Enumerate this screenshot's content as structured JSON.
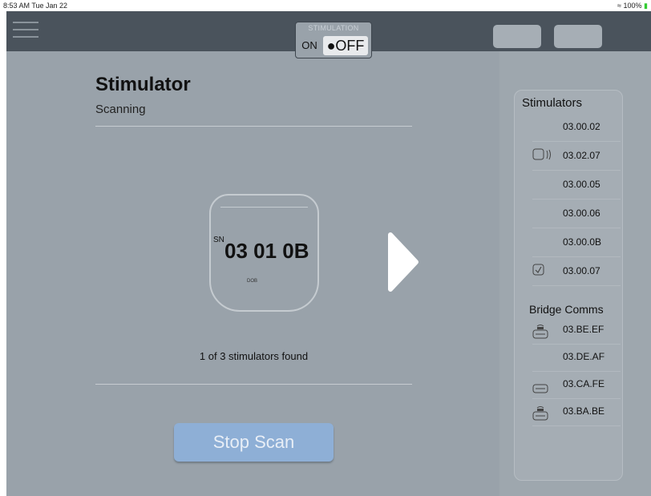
{
  "statusbar": {
    "time": "8:53 AM  Tue Jan 22",
    "right": "100%"
  },
  "navbar": {
    "stim_label": "STIMULATION",
    "on_label": "ON",
    "off_label": "●OFF"
  },
  "main": {
    "title": "Stimulator",
    "subtitle": "Scanning",
    "device": {
      "sn_label": "SN",
      "sn_value": "03 01 0B",
      "dob_label": "DOB"
    },
    "found_text": "1 of 3 stimulators found",
    "stop_button": "Stop Scan"
  },
  "sidebar": {
    "title": "Stimulators",
    "stimulators": [
      {
        "id": "03.00.02",
        "icon": ""
      },
      {
        "id": "03.02.07",
        "icon": "stimulator-signal-icon"
      },
      {
        "id": "03.00.05",
        "icon": ""
      },
      {
        "id": "03.00.06",
        "icon": ""
      },
      {
        "id": "03.00.0B",
        "icon": ""
      },
      {
        "id": "03.00.07",
        "icon": "stimulator-check-icon"
      }
    ],
    "bridge_title": "Bridge Comms",
    "bridges": [
      {
        "id": "03.BE.EF",
        "icon": "bridge-signal-icon"
      },
      {
        "id": "03.DE.AF",
        "icon": ""
      },
      {
        "id": "03.CA.FE",
        "icon": "bridge-icon"
      },
      {
        "id": "03.BA.BE",
        "icon": "bridge-signal-icon"
      }
    ]
  }
}
